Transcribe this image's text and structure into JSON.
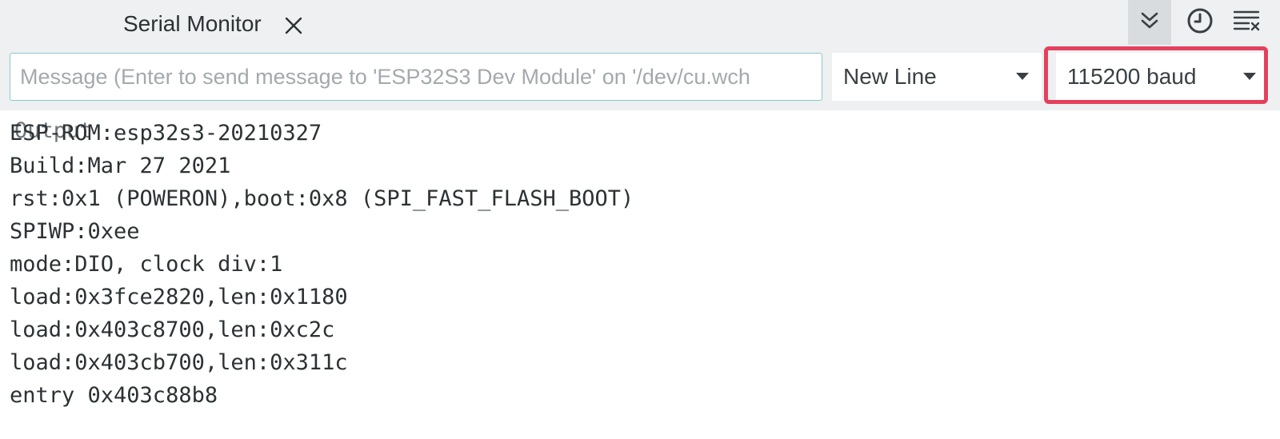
{
  "tabs": {
    "output_label": "Output",
    "serial_monitor_label": "Serial Monitor"
  },
  "toolbar": {
    "icons": [
      "chevrons-down-icon",
      "clock-icon",
      "clear-output-icon",
      "close-icon"
    ]
  },
  "message_input": {
    "placeholder": "Message (Enter to send message to 'ESP32S3 Dev Module' on '/dev/cu.wch",
    "value": ""
  },
  "line_ending_select": {
    "selected": "New Line"
  },
  "baud_select": {
    "selected": "115200 baud"
  },
  "colors": {
    "bar_background": "#eef0f1",
    "input_border": "#86c9cc",
    "highlight_border": "#e4405d",
    "autoscroll_active": "#d9dcde"
  },
  "serial_output": {
    "lines": [
      "ESP-ROM:esp32s3-20210327",
      "Build:Mar 27 2021",
      "rst:0x1 (POWERON),boot:0x8 (SPI_FAST_FLASH_BOOT)",
      "SPIWP:0xee",
      "mode:DIO, clock div:1",
      "load:0x3fce2820,len:0x1180",
      "load:0x403c8700,len:0xc2c",
      "load:0x403cb700,len:0x311c",
      "entry 0x403c88b8"
    ]
  }
}
